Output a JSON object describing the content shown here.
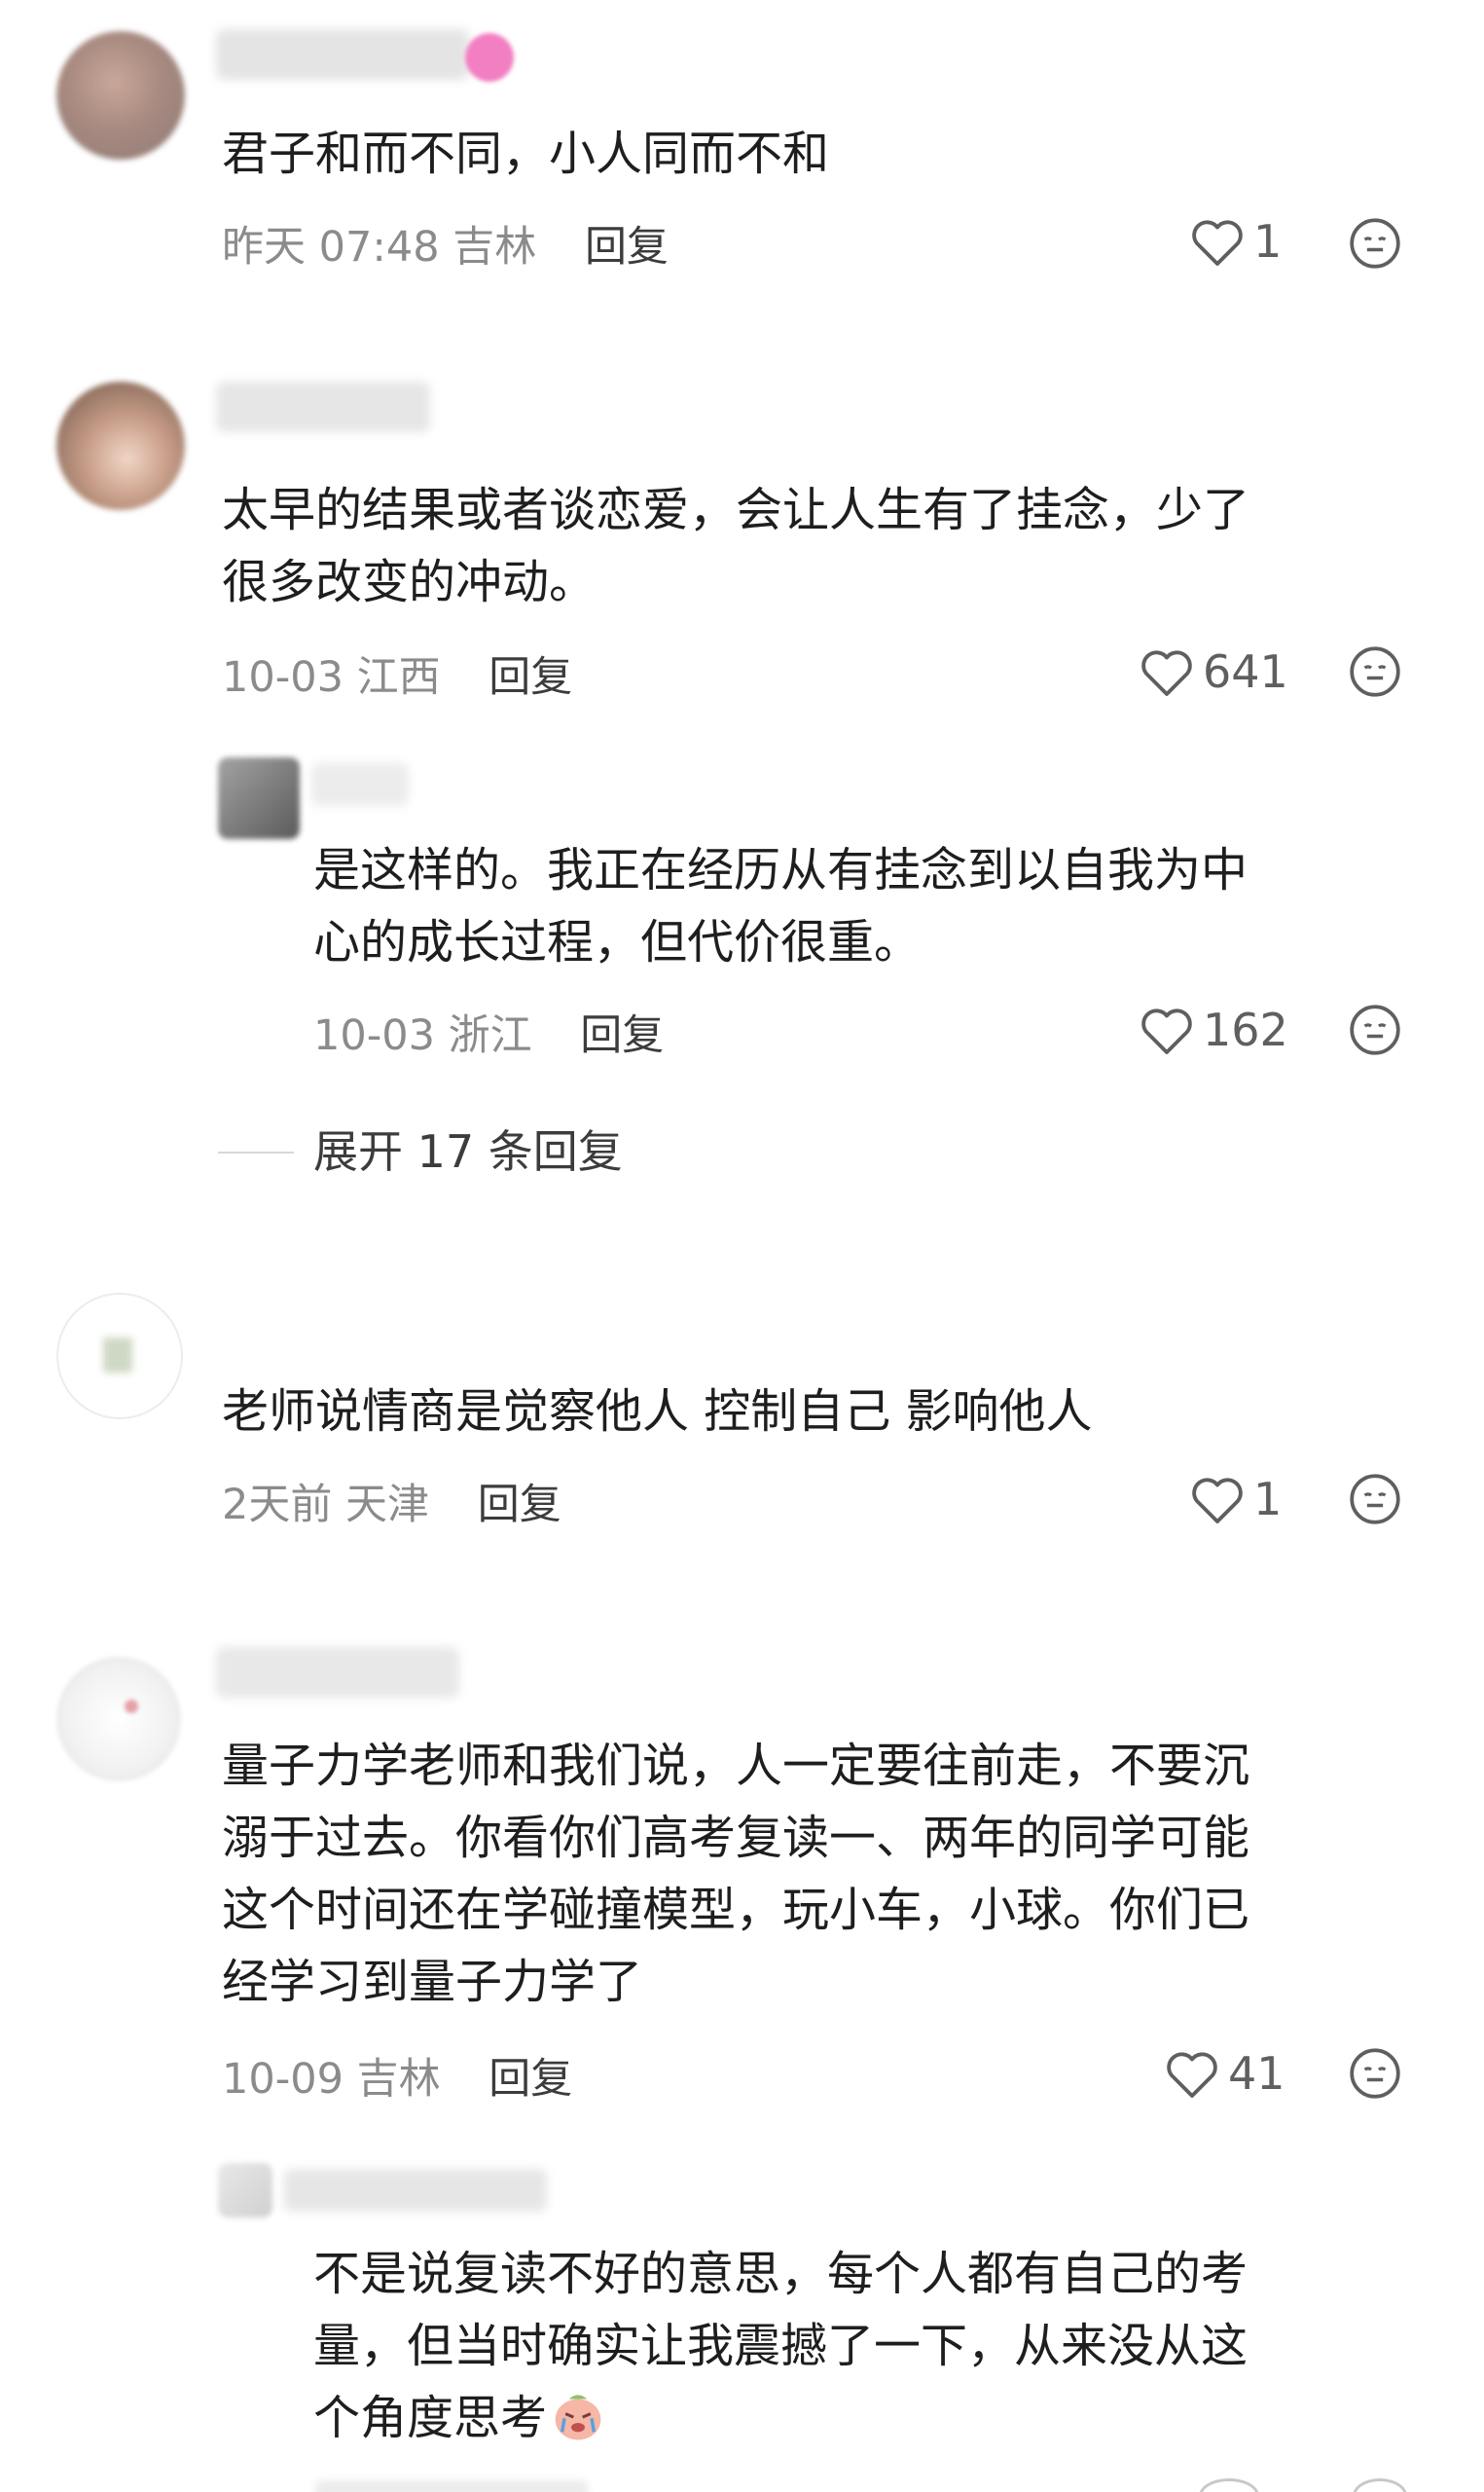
{
  "reply_label": "回复",
  "comments": [
    {
      "text_lines": [
        "君子和而不同，小人同而不和"
      ],
      "time": "昨天 07:48",
      "location": "吉林",
      "likes": "1"
    },
    {
      "text_lines": [
        "太早的结果或者谈恋爱，会让人生有了挂念，少了",
        "很多改变的冲动。"
      ],
      "time": "10-03",
      "location": "江西",
      "likes": "641",
      "replies": [
        {
          "text_lines": [
            "是这样的。我正在经历从有挂念到以自我为中",
            "心的成长过程，但代价很重。"
          ],
          "time": "10-03",
          "location": "浙江",
          "likes": "162"
        }
      ],
      "expand_label": "展开 17 条回复"
    },
    {
      "text_lines": [
        "老师说情商是觉察他人 控制自己 影响他人"
      ],
      "time": "2天前",
      "location": "天津",
      "likes": "1"
    },
    {
      "text_lines": [
        "量子力学老师和我们说，人一定要往前走，不要沉",
        "溺于过去。你看你们高考复读一、两年的同学可能",
        "这个时间还在学碰撞模型，玩小车，小球。你们已",
        "经学习到量子力学了"
      ],
      "time": "10-09",
      "location": "吉林",
      "likes": "41",
      "replies": [
        {
          "text_lines": [
            "不是说复读不好的意思，每个人都有自己的考",
            "量，但当时确实让我震撼了一下，从来没从这",
            "个角度思考"
          ],
          "inline_emoji": "crying-face-sticker"
        }
      ]
    }
  ]
}
